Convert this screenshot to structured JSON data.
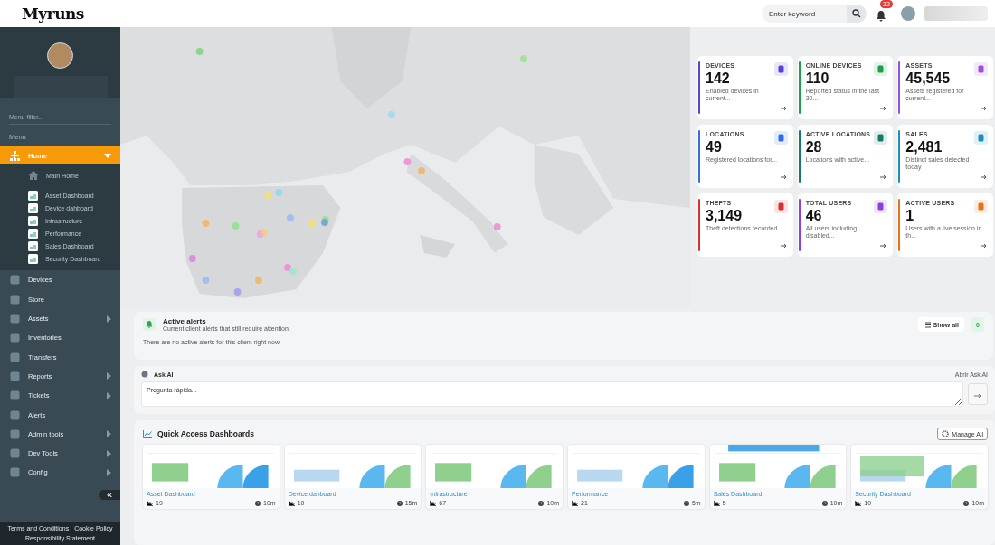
{
  "header": {
    "logo": "Myruns",
    "search": {
      "placeholder": "Enter keyword"
    },
    "notifications": "32"
  },
  "sidebar": {
    "filter_placeholder": "Menu filter...",
    "menu_label": "Menu",
    "items": [
      {
        "label": "Home",
        "expandable": true,
        "selected": true,
        "expanded": true,
        "children": [
          {
            "label": "Main Home",
            "kind": "page"
          },
          {
            "label": "Asset Dashboard",
            "kind": "dashboard"
          },
          {
            "label": "Device dahboard",
            "kind": "dashboard"
          },
          {
            "label": "Infrastructure",
            "kind": "dashboard"
          },
          {
            "label": "Performance",
            "kind": "dashboard"
          },
          {
            "label": "Sales Dashboard",
            "kind": "dashboard"
          },
          {
            "label": "Security Dashboard",
            "kind": "dashboard"
          }
        ]
      },
      {
        "label": "Devices",
        "expandable": false,
        "selected": false
      },
      {
        "label": "Store",
        "expandable": false,
        "selected": false
      },
      {
        "label": "Assets",
        "expandable": true,
        "selected": false
      },
      {
        "label": "Inventories",
        "expandable": false,
        "selected": false
      },
      {
        "label": "Transfers",
        "expandable": false,
        "selected": false
      },
      {
        "label": "Reports",
        "expandable": true,
        "selected": false
      },
      {
        "label": "Tickets",
        "expandable": true,
        "selected": false
      },
      {
        "label": "Alerts",
        "expandable": false,
        "selected": false
      },
      {
        "label": "Admin tools",
        "expandable": true,
        "selected": false
      },
      {
        "label": "Dev Tools",
        "expandable": true,
        "selected": false
      },
      {
        "label": "Config",
        "expandable": true,
        "selected": false
      }
    ],
    "collapse": "«",
    "footer": [
      "Terms and Conditions",
      "Cookie Policy",
      "Responsibility Statement"
    ]
  },
  "stats": [
    {
      "label": "DEVICES",
      "value": "142",
      "description": "Enabled devices in current...",
      "color": "#5b3fd6"
    },
    {
      "label": "ONLINE DEVICES",
      "value": "110",
      "description": "Reported status in the last 30...",
      "color": "#1e9e4a"
    },
    {
      "label": "ASSETS",
      "value": "45,545",
      "description": "Assets registered for current...",
      "color": "#9b4fe0"
    },
    {
      "label": "LOCATIONS",
      "value": "49",
      "description": "Registered locations for...",
      "color": "#2f6fe0"
    },
    {
      "label": "ACTIVE LOCATIONS",
      "value": "28",
      "description": "Locations with active...",
      "color": "#137a68"
    },
    {
      "label": "SALES",
      "value": "2,481",
      "description": "Distinct sales detected today",
      "color": "#1a8fc0"
    },
    {
      "label": "THEFTS",
      "value": "3,149",
      "description": "Theft detections recorded...",
      "color": "#d8302f"
    },
    {
      "label": "TOTAL USERS",
      "value": "46",
      "description": "All users including disabled...",
      "color": "#8a3fe0"
    },
    {
      "label": "ACTIVE USERS",
      "value": "1",
      "description": "Users with a live session in th...",
      "color": "#e8701c"
    }
  ],
  "alerts": {
    "title": "Active alerts",
    "subtitle": "Current client alerts that still require attention.",
    "empty_message": "There are no active alerts for this client right now.",
    "show_all": "Show all",
    "count": "0"
  },
  "ask_ai": {
    "title": "Ask AI",
    "open_link": "Abrir Ask AI",
    "placeholder": "Pregunta rápida..."
  },
  "quick_access": {
    "title": "Quick Access Dashboards",
    "manage": "Manage All",
    "dashboards": [
      {
        "name": "Asset Dashboard",
        "count": "19",
        "time": "10m"
      },
      {
        "name": "Device dahboard",
        "count": "10",
        "time": "15m"
      },
      {
        "name": "Infrastructure",
        "count": "67",
        "time": "10m"
      },
      {
        "name": "Performance",
        "count": "21",
        "time": "5m"
      },
      {
        "name": "Sales Dashboard",
        "count": "5",
        "time": "10m"
      },
      {
        "name": "Security Dashboard",
        "count": "10",
        "time": "10m"
      }
    ]
  }
}
